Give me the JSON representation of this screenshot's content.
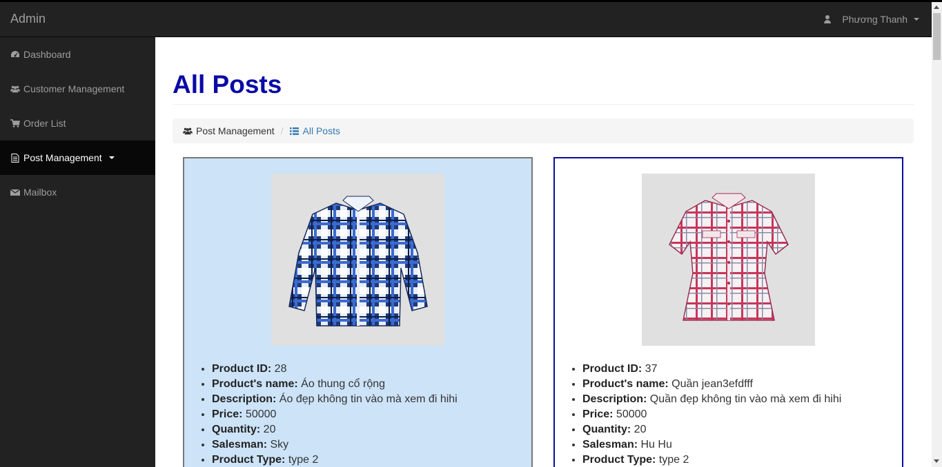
{
  "navbar": {
    "brand": "Admin",
    "user_name": "Phương Thanh",
    "user_icon": "user-icon"
  },
  "sidebar": {
    "items": [
      {
        "label": "Dashboard",
        "icon": "dashboard-icon",
        "active": false
      },
      {
        "label": "Customer Management",
        "icon": "users-icon",
        "active": false
      },
      {
        "label": "Order List",
        "icon": "cart-icon",
        "active": false
      },
      {
        "label": "Post Management",
        "icon": "file-icon",
        "active": true
      },
      {
        "label": "Mailbox",
        "icon": "envelope-icon",
        "active": false
      }
    ]
  },
  "page": {
    "title": "All Posts",
    "title_color": "#0a0aa6",
    "breadcrumb": [
      {
        "label": "Post Management",
        "icon": "users-icon"
      },
      {
        "label": "All Posts",
        "icon": "list-icon"
      }
    ]
  },
  "posts": [
    {
      "labels": {
        "id": "Product ID:",
        "name": "Product's name:",
        "description": "Description:",
        "price": "Price:",
        "quantity": "Quantity:",
        "salesman": "Salesman:",
        "type": "Product Type:"
      },
      "id": "28",
      "name": "Áo thung cổ rộng",
      "description": "Áo đẹp không tin vào mà xem đi hihi",
      "price": "50000",
      "quantity": "20",
      "salesman": "Sky",
      "type": "type 2",
      "image": "blue-plaid-shirt"
    },
    {
      "labels": {
        "id": "Product ID:",
        "name": "Product's name:",
        "description": "Description:",
        "price": "Price:",
        "quantity": "Quantity:",
        "salesman": "Salesman:",
        "type": "Product Type:"
      },
      "id": "37",
      "name": "Quần jean3efdfff",
      "description": "Quần đẹp không tin vào mà xem đi hihi",
      "price": "50000",
      "quantity": "20",
      "salesman": "Hu Hu",
      "type": "type 2",
      "image": "pink-plaid-blouse"
    }
  ]
}
